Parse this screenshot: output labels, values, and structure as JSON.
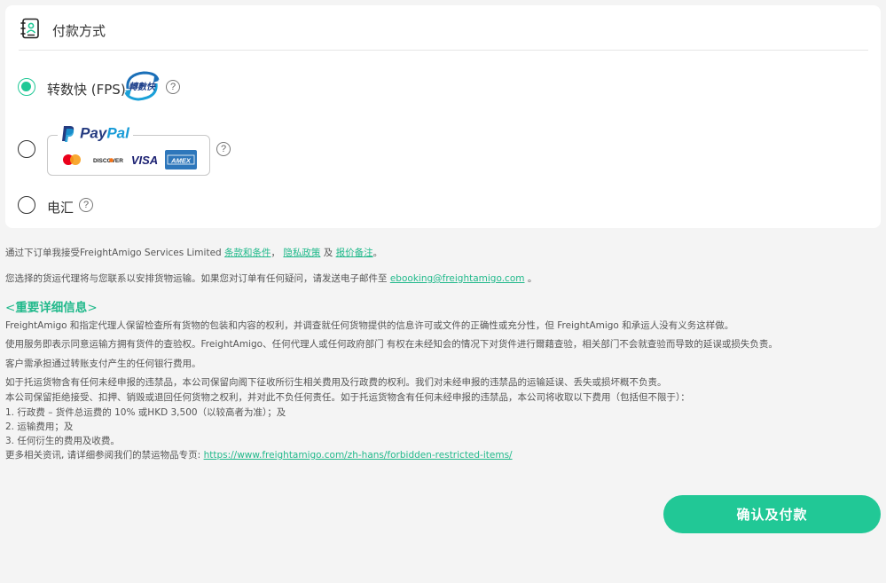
{
  "section": {
    "title": "付款方式",
    "icon": "payment-book-icon"
  },
  "options": [
    {
      "label": "转数快 (FPS)",
      "checked": true,
      "logo_text": "轉數快"
    },
    {
      "label": "PayPal",
      "checked": false,
      "logo_pay": "Pay",
      "logo_pal": "Pal",
      "cards": [
        "mastercard",
        "DISCOVER",
        "VISA",
        "AMEX"
      ]
    },
    {
      "label": "电汇",
      "checked": false
    }
  ],
  "help_symbol": "?",
  "terms": {
    "prefix": "通过下订单我接受FreightAmigo Services Limited ",
    "link1": "条款和条件",
    "sep1": "， ",
    "link2": "隐私政策",
    "sep2": " 及 ",
    "link3": "报价备注",
    "suffix": "。"
  },
  "contact": {
    "prefix": "您选择的货运代理将与您联系以安排货物运输。如果您对订单有任何疑问，请发送电子邮件至 ",
    "email": "ebooking@freightamigo.com",
    "suffix": " 。"
  },
  "important": {
    "open": "<",
    "title": "重要详细信息",
    "close": ">"
  },
  "paragraphs": [
    "FreightAmigo 和指定代理人保留检查所有货物的包装和内容的权利，并调查就任何货物提供的信息许可或文件的正确性或充分性，但 FreightAmigo 和承运人没有义务这样做。",
    "使用服务即表示同意运输方拥有货件的查验权。FreightAmigo、任何代理人或任何政府部门 有权在未经知会的情况下对货件进行爾藉查验，相关部门不会就查验而导致的延误或损失负责。",
    "客户需承担通过转账支付产生的任何银行费用。",
    "如于托运货物含有任何未经申报的违禁品，本公司保留向阁下征收所衍生相关费用及行政费的权利。我们对未经申报的违禁品的运输延误、丢失或损坏概不负责。",
    "本公司保留拒绝接受、扣押、销毁或退回任何货物之权利，并对此不负任何责任。如于托运货物含有任何未经申报的违禁品，本公司将收取以下费用（包括但不限于）：",
    "1. 行政费 – 货件总运费的 10% 或HKD 3,500（以较高者为准）；及",
    "2. 运输费用；及",
    "3. 任何衍生的费用及收费。"
  ],
  "more_info": {
    "prefix": "更多相关资讯, 请详细参阅我们的禁运物品专页: ",
    "url": "https://www.freightamigo.com/zh-hans/forbidden-restricted-items/"
  },
  "confirm_button": "确认及付款",
  "colors": {
    "accent": "#21c896",
    "link": "#21b98b",
    "paypal_dark": "#253b80",
    "paypal_light": "#179bd7"
  }
}
